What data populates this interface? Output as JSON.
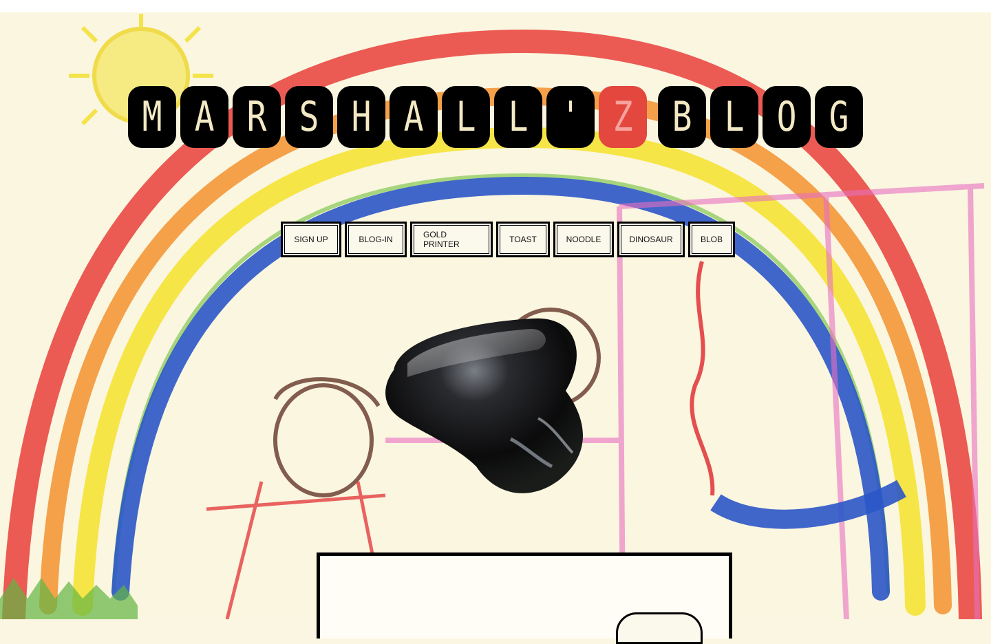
{
  "site": {
    "title_letters": [
      "M",
      "A",
      "R",
      "S",
      "H",
      "A",
      "L",
      "L",
      "'",
      "Z",
      " ",
      "B",
      "L",
      "O",
      "G"
    ],
    "highlight_index": 9,
    "accent_color": "#e4473e"
  },
  "nav": {
    "items": [
      {
        "label": "SIGN UP"
      },
      {
        "label": "BLOG-IN"
      },
      {
        "label": "GOLD PRINTER"
      },
      {
        "label": "TOAST"
      },
      {
        "label": "NOODLE"
      },
      {
        "label": "DINOSAUR"
      },
      {
        "label": "BLOB"
      }
    ]
  },
  "hero": {
    "image": "black-glossy-blob"
  },
  "background": {
    "image": "child-crayon-drawing-rainbow"
  }
}
